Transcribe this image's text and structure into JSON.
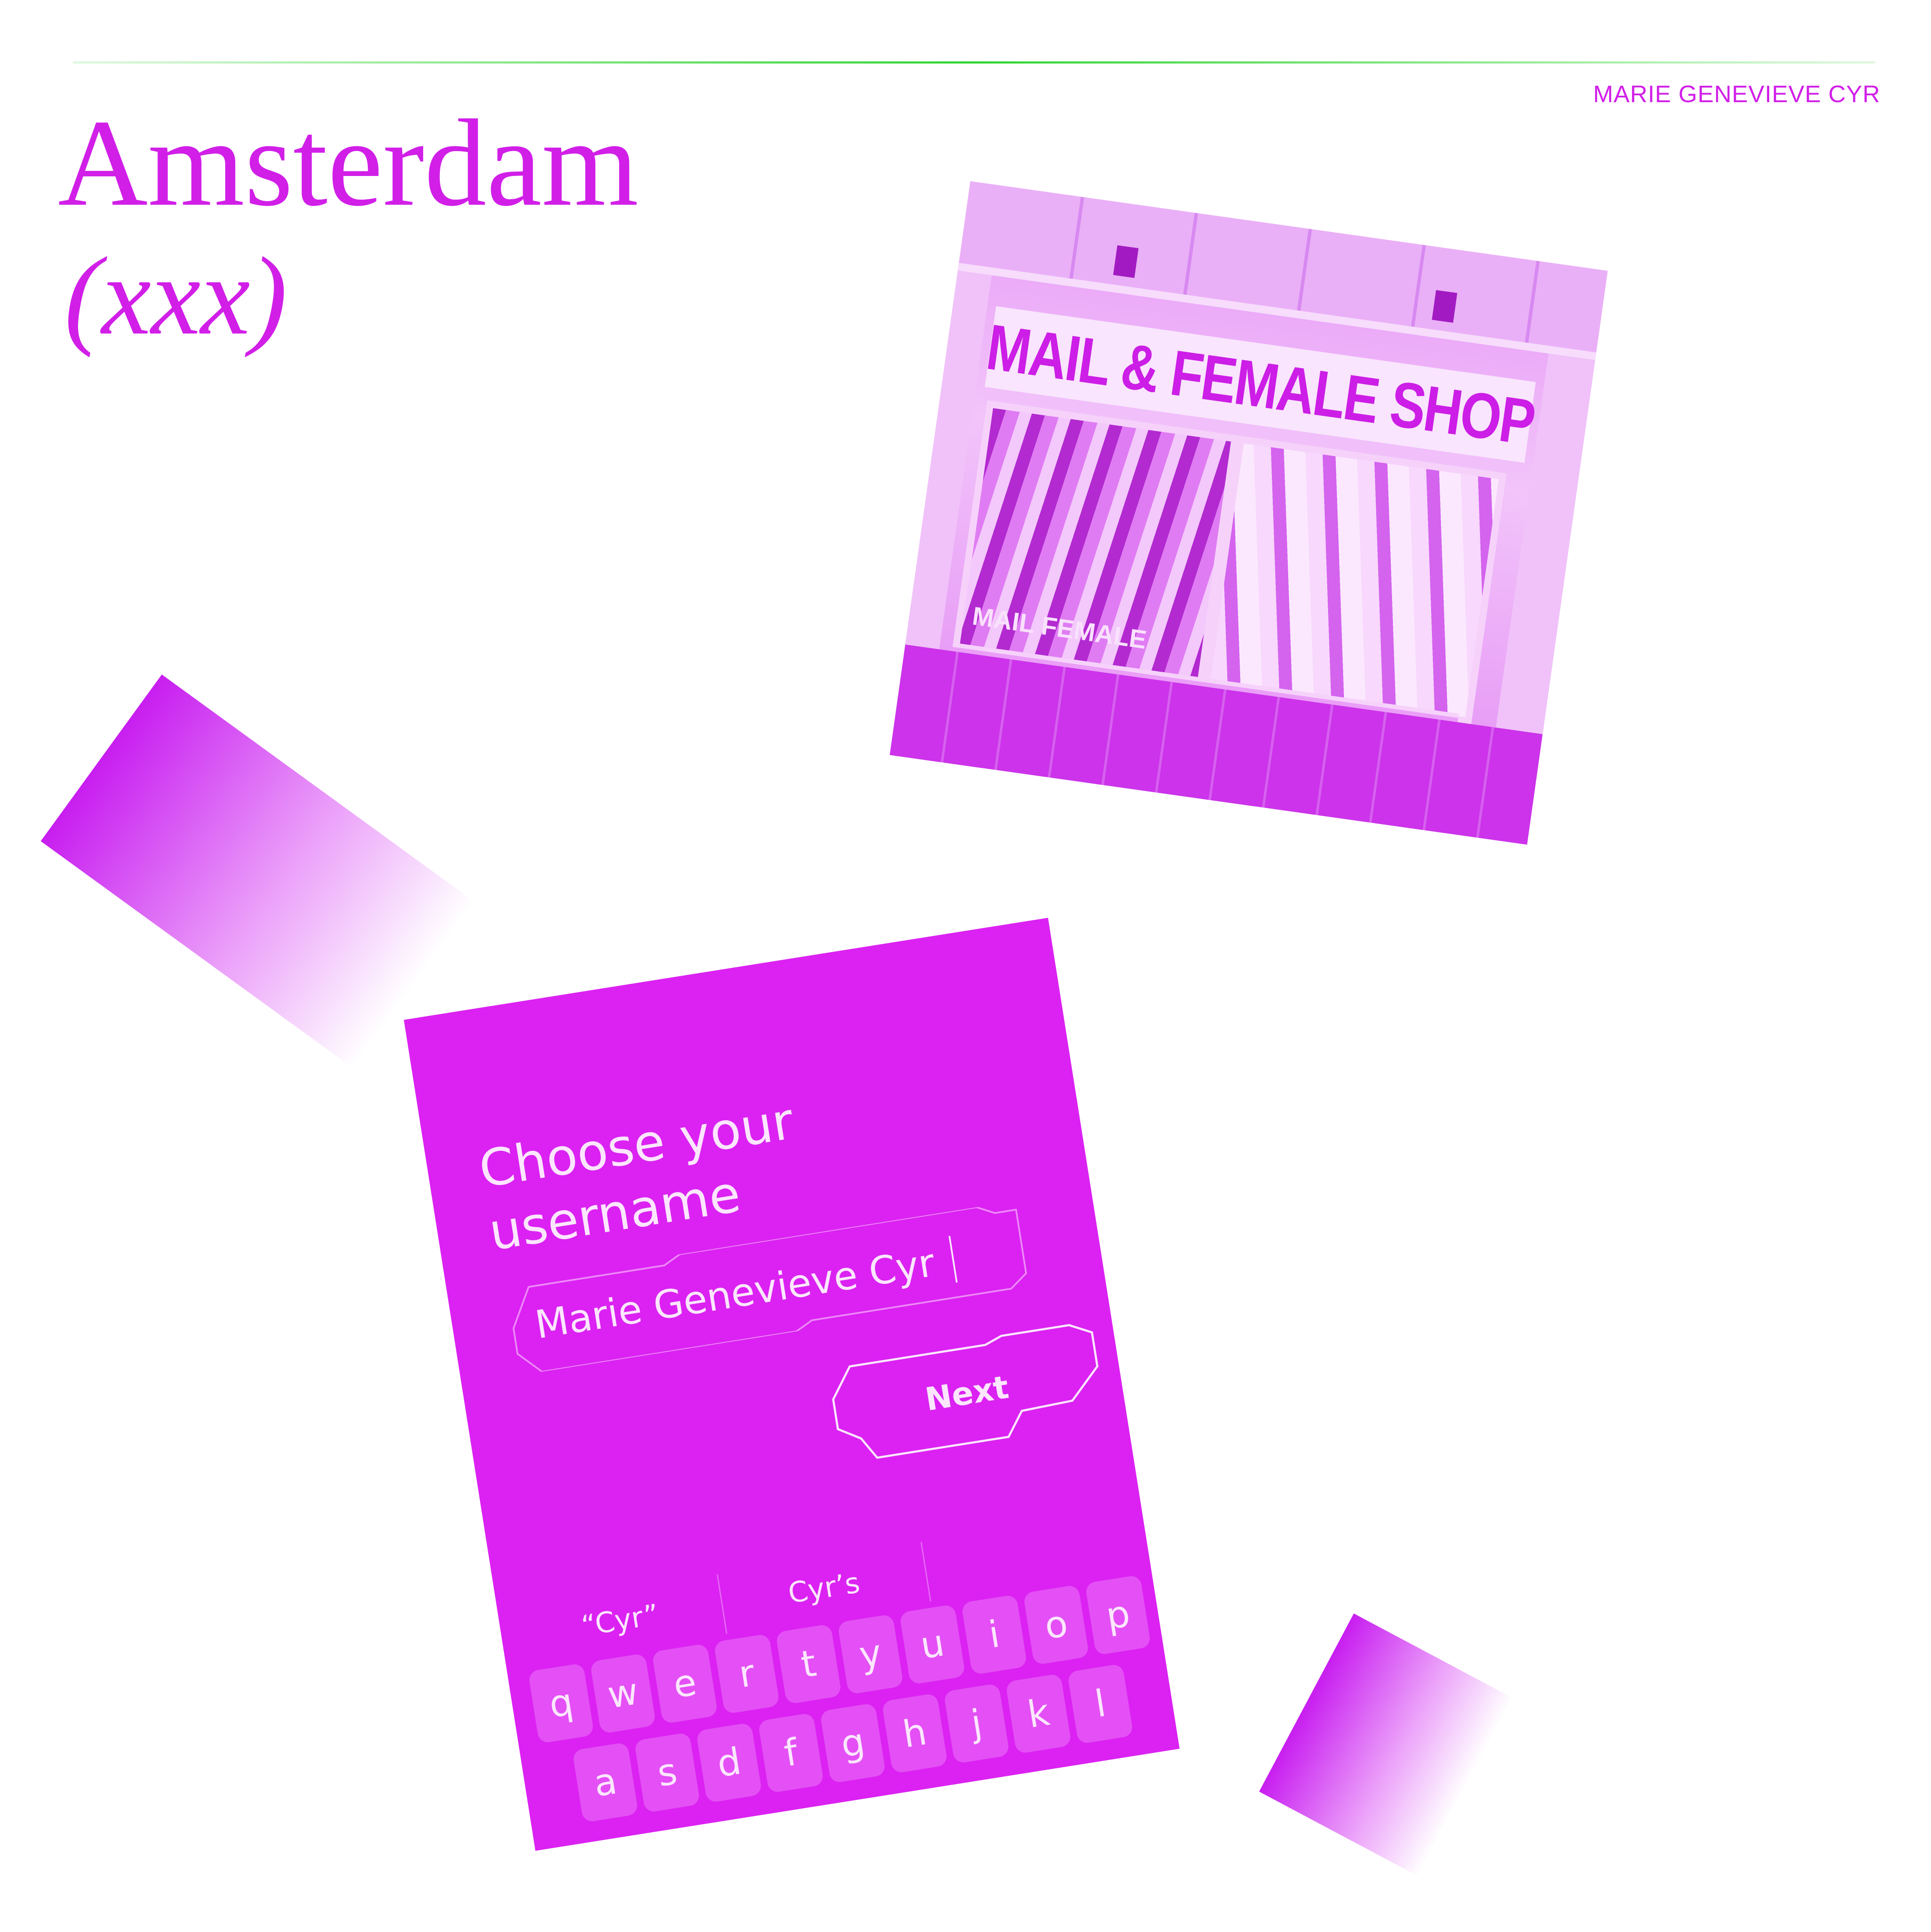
{
  "page": {
    "title": "Amsterdam",
    "subtitle": "(xxx)",
    "author": "MARIE GENEVIEVE CYR"
  },
  "photo": {
    "sign_text": "MAIL & FEMALE SHOP",
    "window_text": "MAIL FEMALE"
  },
  "signup": {
    "heading": "Choose your username",
    "username_value": "Marie Genevieve Cyr",
    "next_label": "Next",
    "suggestions": [
      "“Cyr”",
      "Cyr’s",
      ""
    ],
    "keyboard_rows": [
      [
        "q",
        "w",
        "e",
        "r",
        "t",
        "y",
        "u",
        "i",
        "o",
        "p"
      ],
      [
        "a",
        "s",
        "d",
        "f",
        "g",
        "h",
        "j",
        "k",
        "l"
      ]
    ]
  },
  "colors": {
    "accent": "#d11fe8",
    "card": "#db22f2",
    "rule": "#2fd62f",
    "card_text": "#fbe6fe"
  }
}
